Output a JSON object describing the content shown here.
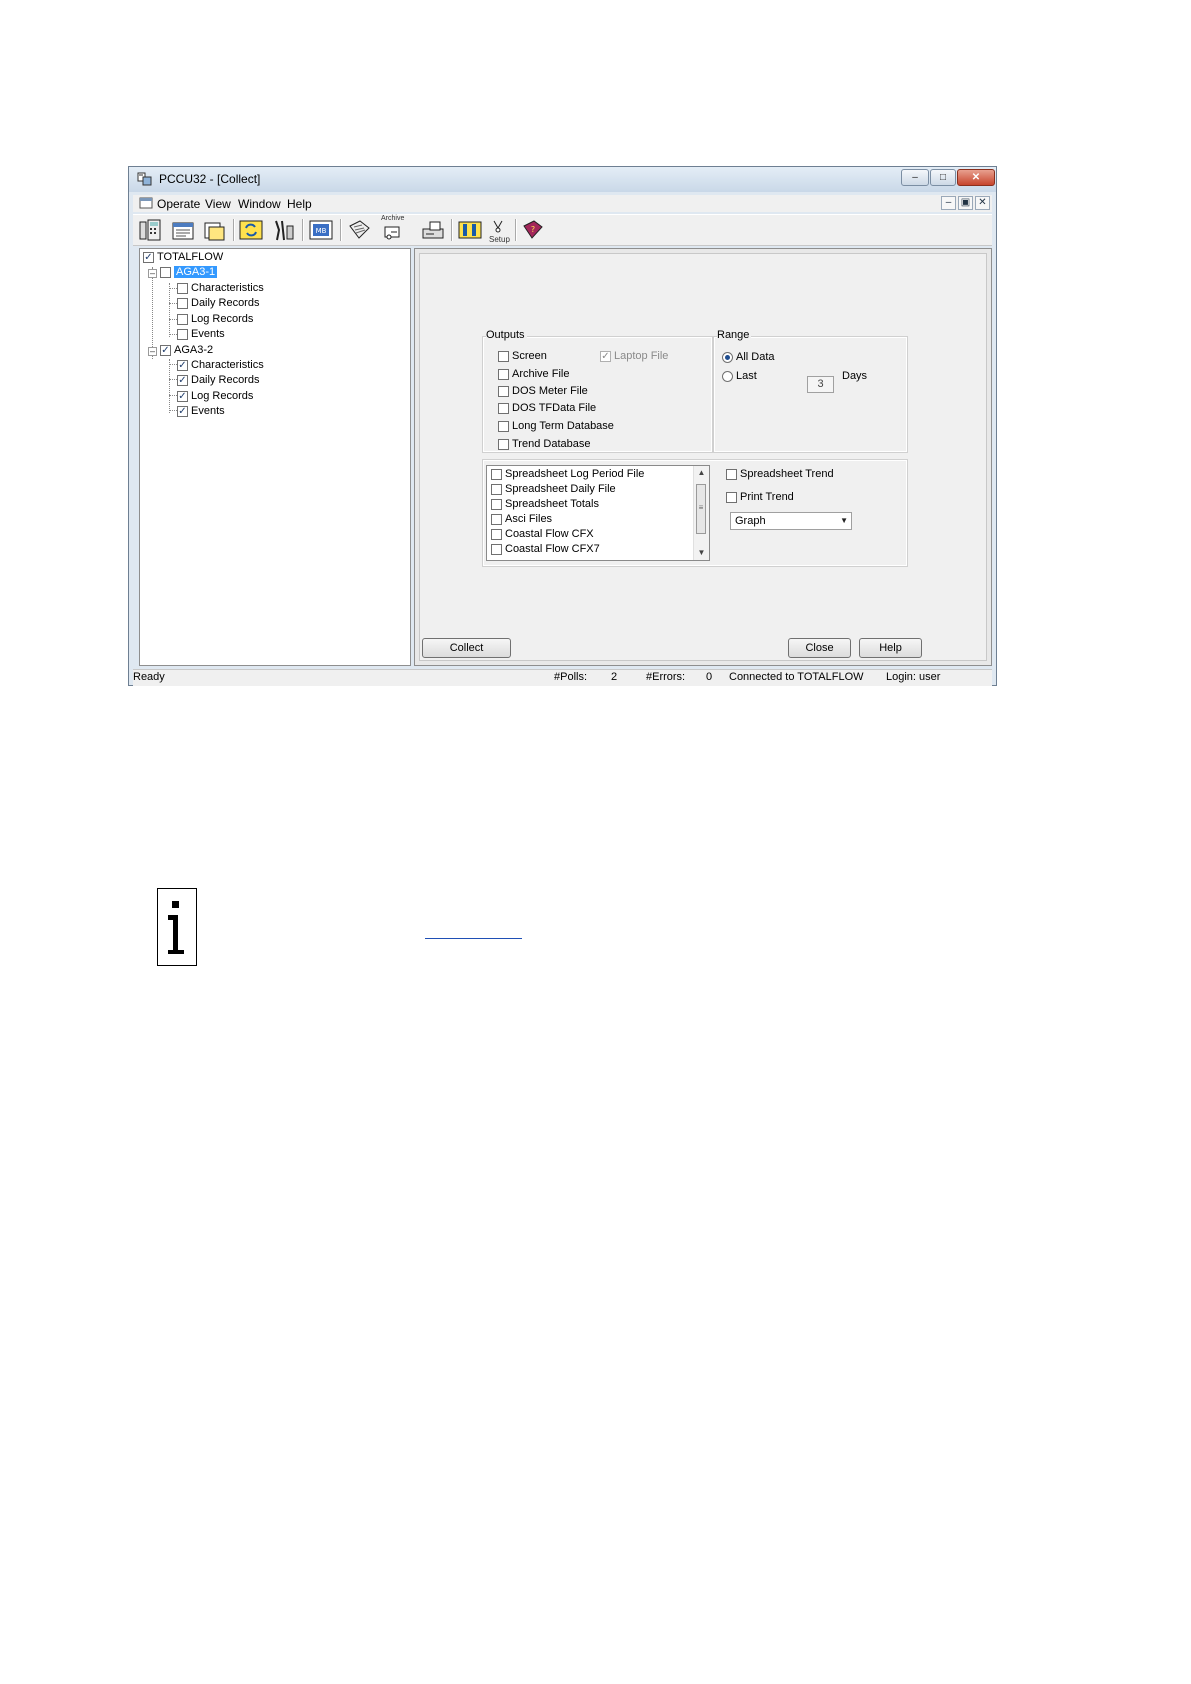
{
  "window": {
    "title": "PCCU32 - [Collect]",
    "caption": {
      "minimize": "–",
      "maximize": "□",
      "close": "✕"
    }
  },
  "menubar": {
    "items": [
      "Operate",
      "View",
      "Window",
      "Help"
    ],
    "mdi": {
      "minimize": "–",
      "restore": "▣",
      "close": "✕"
    }
  },
  "toolbar": {
    "archive_caption": "Archive",
    "setup_caption": "Setup"
  },
  "tree": {
    "root": {
      "label": "TOTALFLOW",
      "checked": true
    },
    "groups": [
      {
        "label": "AGA3-1",
        "checked": false,
        "selected": true,
        "children": [
          {
            "label": "Characteristics",
            "checked": false
          },
          {
            "label": "Daily Records",
            "checked": false
          },
          {
            "label": "Log Records",
            "checked": false
          },
          {
            "label": "Events",
            "checked": false
          }
        ]
      },
      {
        "label": "AGA3-2",
        "checked": true,
        "selected": false,
        "children": [
          {
            "label": "Characteristics",
            "checked": true
          },
          {
            "label": "Daily Records",
            "checked": true
          },
          {
            "label": "Log Records",
            "checked": true
          },
          {
            "label": "Events",
            "checked": true
          }
        ]
      }
    ]
  },
  "outputs": {
    "label": "Outputs",
    "screen": "Screen",
    "laptop_file": "Laptop File",
    "archive_file": "Archive File",
    "dos_meter_file": "DOS Meter File",
    "dos_tfdata_file": "DOS TFData File",
    "long_term_database": "Long Term Database",
    "trend_database": "Trend Database"
  },
  "range": {
    "label": "Range",
    "all_data": "All Data",
    "last": "Last",
    "days_value": "3",
    "days_label": "Days"
  },
  "file_list": [
    "Spreadsheet Log Period File",
    "Spreadsheet Daily File",
    "Spreadsheet Totals",
    "Asci Files",
    "Coastal Flow CFX",
    "Coastal Flow CFX7"
  ],
  "trend": {
    "spreadsheet_trend": "Spreadsheet Trend",
    "print_trend": "Print Trend",
    "graph_select": "Graph"
  },
  "buttons": {
    "collect": "Collect",
    "close": "Close",
    "help": "Help"
  },
  "status": {
    "ready": "Ready",
    "polls_label": "#Polls:",
    "polls_value": "2",
    "errors_label": "#Errors:",
    "errors_value": "0",
    "connection": "Connected to TOTALFLOW",
    "login": "Login: user"
  },
  "colors": {
    "selection": "#3399ff",
    "window_frame": "#dfe8f1",
    "close_button": "#c7452c"
  }
}
